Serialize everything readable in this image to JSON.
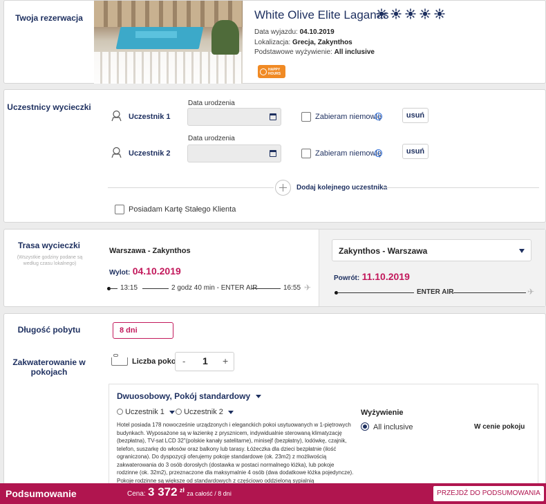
{
  "reservation": {
    "section_label": "Twoja rezerwacja",
    "hotel_name": "White Olive Elite Laganas",
    "star_count": 5,
    "departure_label": "Data wyjazdu:",
    "departure_value": "04.10.2019",
    "location_label": "Lokalizacja:",
    "location_value": "Grecja, Zakynthos",
    "board_label": "Podstawowe wyżywienie:",
    "board_value": "All inclusive",
    "badge_line1": "HAPPY",
    "badge_line2": "HOURS"
  },
  "participants": {
    "section_label": "Uczestnicy wycieczki",
    "items": [
      {
        "name": "Uczestnik 1",
        "birth_label": "Data urodzenia",
        "birth_value": "",
        "infant_label": "Zabieram niemowlę",
        "remove_label": "usuń"
      },
      {
        "name": "Uczestnik 2",
        "birth_label": "Data urodzenia",
        "birth_value": "",
        "infant_label": "Zabieram niemowlę",
        "remove_label": "usuń"
      }
    ],
    "add_label": "Dodaj kolejnego uczestnika",
    "loyalty_label": "Posiadam Kartę Stałego Klienta"
  },
  "route": {
    "section_label": "Trasa wycieczki",
    "section_note": "(Wszystkie godziny podane są według czasu lokalnego)",
    "outbound": {
      "route": "Warszawa - Zakynthos",
      "date_label": "Wylot:",
      "date_value": "04.10.2019",
      "dep_time": "13:15",
      "duration": "2 godz 40 min - ENTER AIR",
      "arr_time": "16:55"
    },
    "return": {
      "route": "Zakynthos - Warszawa",
      "date_label": "Powrót:",
      "date_value": "11.10.2019",
      "carrier": "ENTER AIR"
    }
  },
  "stay": {
    "length_label": "Długość pobytu",
    "length_value": "8 dni",
    "accommodation_label": "Zakwaterowanie w pokojach",
    "rooms_label": "Liczba pokoi",
    "rooms_minus": "-",
    "rooms_value": "1",
    "rooms_plus": "+",
    "room_type": "Dwuosobowy, Pokój standardowy",
    "room_participant_1": "Uczestnik 1",
    "room_participant_2": "Uczestnik 2",
    "description": "Hotel posiada 178 nowocześnie urządzonych i eleganckich pokoi usytuowanych w 1-piętrowych budynkach. Wyposażone są w łazienkę z prysznicem, indywidualnie sterowaną klimatyzację (bezpłatna), TV-sat LCD 32\"(polskie kanały satelitarne), minisejf (bezpłatny), lodówkę, czajnik, telefon, suszarkę do włosów oraz balkony lub tarasy. Łóżeczka dla dzieci bezpłatnie (ilość ograniczona). Do dyspozycji oferujemy pokoje standardowe (ok. 23m2) z możliwością zakwaterowania do 3 osób dorosłych (dostawka w postaci normalnego łóżka), lub pokoje rodzinne (ok. 32m2), przeznaczone dla maksymalnie 4 osób (dwa dodatkowe łóżka pojedyncze). Pokoje rodzinne są większe od standardowych z częściowo oddzieloną sypialnią",
    "meal_title": "Wyżywienie",
    "meal_option": "All inclusive",
    "meal_price": "W cenie pokoju"
  },
  "summary": {
    "title": "Podsumowanie",
    "price_label": "Cena:",
    "price_value": "3 372",
    "price_currency": "zł",
    "price_note": "za całość / 8 dni",
    "cta_label": "PRZEJDŹ DO PODSUMOWANIA"
  },
  "colors": {
    "navy": "#1d2f5f",
    "accent": "#c2185b",
    "summary_bar": "#b0154f",
    "badge": "#f08a24"
  }
}
